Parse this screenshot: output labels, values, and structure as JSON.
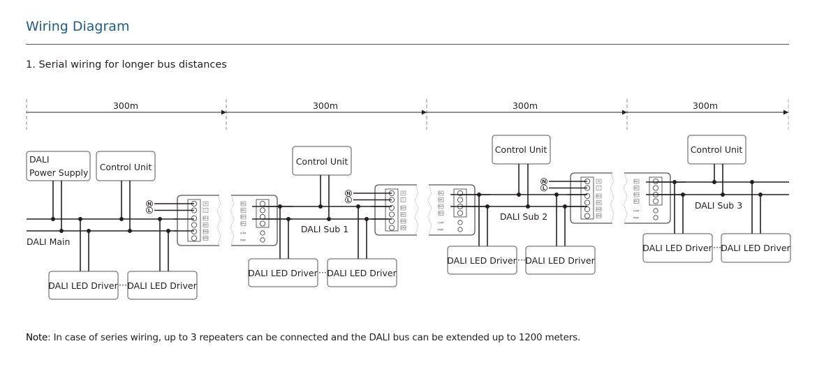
{
  "header": {
    "title": "Wiring Diagram",
    "subtitle": "1. Serial wiring for longer bus distances"
  },
  "distances": [
    {
      "label": "300m"
    },
    {
      "label": "300m"
    },
    {
      "label": "300m"
    },
    {
      "label": "300m"
    }
  ],
  "segments": {
    "main": {
      "bus_label": "DALI Main",
      "power_supply": [
        "DALI",
        "Power Supply"
      ],
      "control_unit": "Control Unit",
      "drivers": [
        "DALI LED Driver",
        "DALI LED Driver"
      ],
      "ellipsis": "···"
    },
    "sub1": {
      "bus_label": "DALI Sub 1",
      "control_unit": "Control Unit",
      "drivers": [
        "DALI LED Driver",
        "DALI LED Driver"
      ],
      "ellipsis": "···"
    },
    "sub2": {
      "bus_label": "DALI Sub 2",
      "control_unit": "Control Unit",
      "drivers": [
        "DALI LED Driver",
        "DALI LED Driver"
      ],
      "ellipsis": "···"
    },
    "sub3": {
      "bus_label": "DALI Sub 3",
      "control_unit": "Control Unit",
      "drivers": [
        "DALI LED Driver",
        "DALI LED Driver"
      ],
      "ellipsis": "···"
    }
  },
  "repeater": {
    "input_labels": [
      "N",
      "L",
      "DA+",
      "DA-",
      "DA2",
      "DA2"
    ],
    "output_labels": [
      "DA-",
      "DA-",
      "DA+",
      "DA+"
    ],
    "side_labels": [
      "COM",
      "PWR"
    ],
    "mains_terminals": [
      "N",
      "L"
    ]
  },
  "note": {
    "prefix": "Note",
    "text": ": In case of series wiring, up to 3 repeaters can be connected and the DALI bus can be extended up to 1200 meters."
  },
  "colors": {
    "title": "#1f5c8b",
    "line": "#231f20",
    "box_border": "#555555",
    "dashed": "#888888"
  }
}
